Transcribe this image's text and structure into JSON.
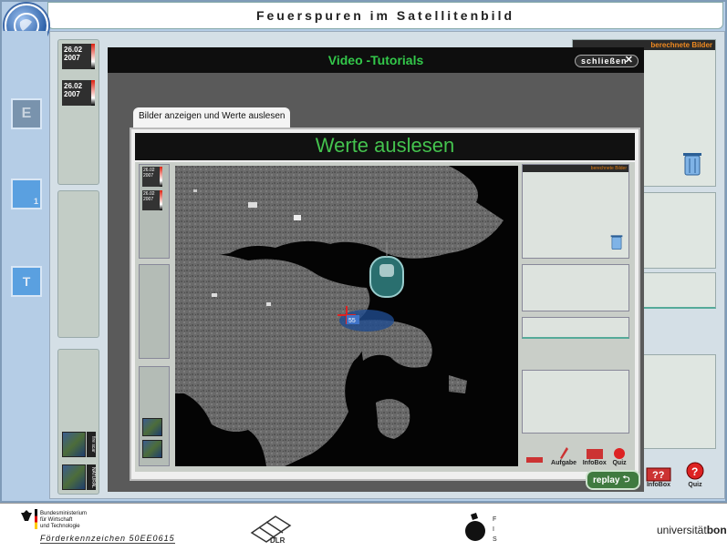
{
  "app": {
    "title": "Feuerspuren im Satellitenbild",
    "left_buttons": [
      {
        "label": "E"
      },
      {
        "label": "",
        "sub": "1"
      },
      {
        "label": "T"
      }
    ],
    "thumbnails": [
      {
        "date": "26.02",
        "year": "2007"
      },
      {
        "date": "26.02",
        "year": "2007"
      }
    ],
    "mini_labels": [
      "fire scar",
      "NATURAL"
    ],
    "right_header": "berechnete Bilder",
    "tools": [
      {
        "label": "InfoBox",
        "icon": "infobox-icon"
      },
      {
        "label": "Quiz",
        "icon": "quiz-icon"
      }
    ]
  },
  "modal": {
    "title": "Video -Tutorials",
    "close_label": "schließen",
    "tab_label": "Bilder anzeigen und Werte auslesen",
    "video_title": "Werte auslesen",
    "replay_label": "replay",
    "video": {
      "thumbnails": [
        {
          "date": "26.02",
          "year": "2007"
        },
        {
          "date": "26.02",
          "year": "2007"
        }
      ],
      "right_header": "berechnete Bilder",
      "pointer_value": "55",
      "tools": [
        {
          "label": ""
        },
        {
          "label": "Aufgabe"
        },
        {
          "label": "InfoBox"
        },
        {
          "label": "Quiz"
        }
      ]
    }
  },
  "footer": {
    "ministry_lines": [
      "Bundesministerium",
      "für Wirtschaft",
      "und Technologie"
    ],
    "funding": "Förderkennzeichen 50EE0615",
    "dlr": "DLR",
    "fis_letters": [
      "F",
      "I",
      "S"
    ],
    "university": "universität",
    "university_bold": "bonn"
  },
  "colors": {
    "accent_green": "#33c84a",
    "accent_orange": "#f08a20",
    "frame_blue": "#b5cde6"
  }
}
